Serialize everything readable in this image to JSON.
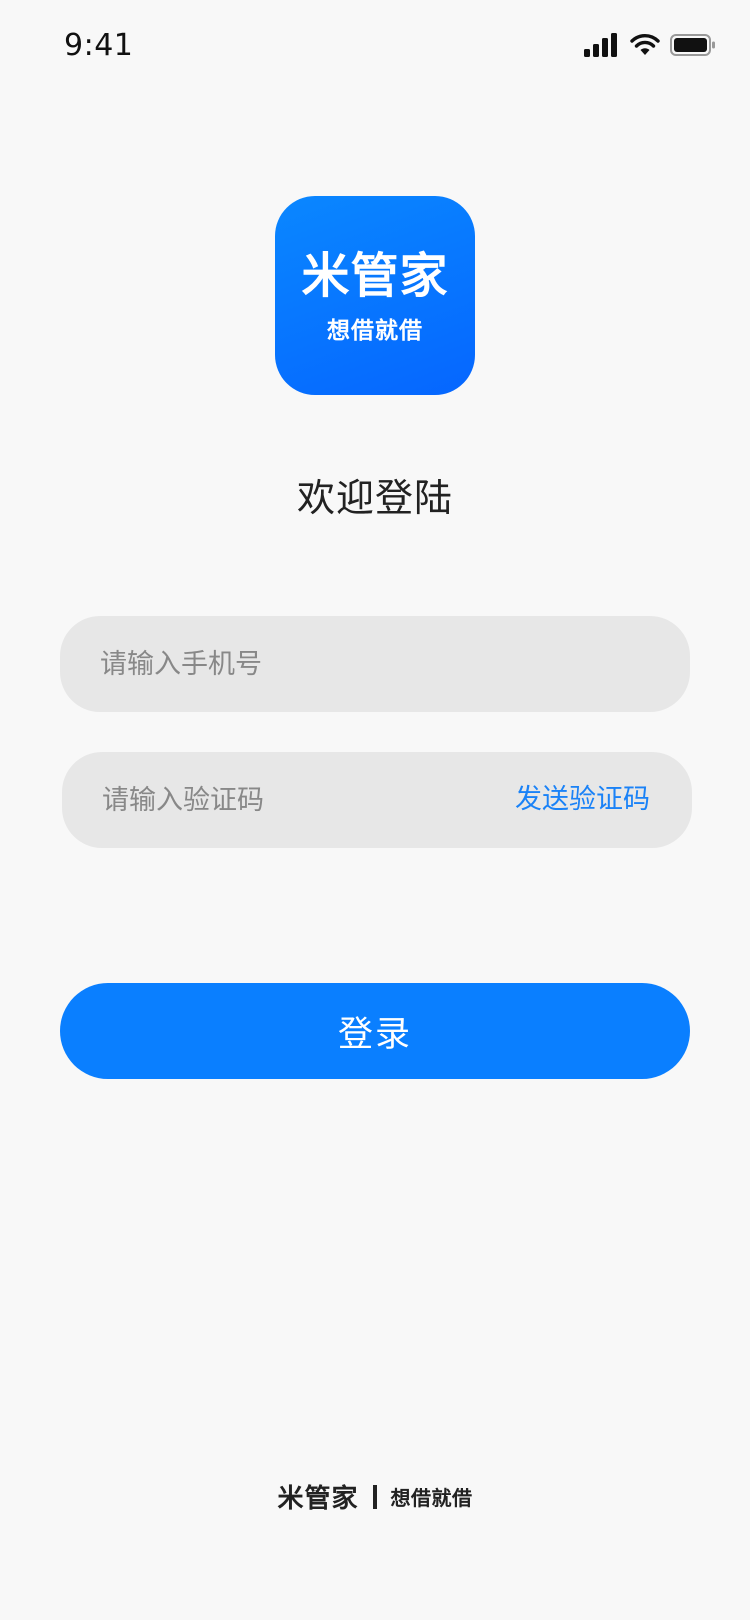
{
  "status_bar": {
    "time": "9:41",
    "icons": [
      "cellular-signal-icon",
      "wifi-icon",
      "battery-icon"
    ]
  },
  "logo": {
    "name": "米管家",
    "slogan": "想借就借",
    "background_color": "#0a7fff"
  },
  "welcome": {
    "title": "欢迎登陆"
  },
  "form": {
    "phone": {
      "value": "",
      "placeholder": "请输入手机号"
    },
    "code": {
      "value": "",
      "placeholder": "请输入验证码",
      "send_label": "发送验证码"
    },
    "login_label": "登录"
  },
  "footer": {
    "name": "米管家",
    "slogan": "想借就借"
  },
  "colors": {
    "accent": "#0a7fff",
    "link": "#1a82f7",
    "background": "#f8f8f8",
    "input_background": "#e7e7e7"
  }
}
